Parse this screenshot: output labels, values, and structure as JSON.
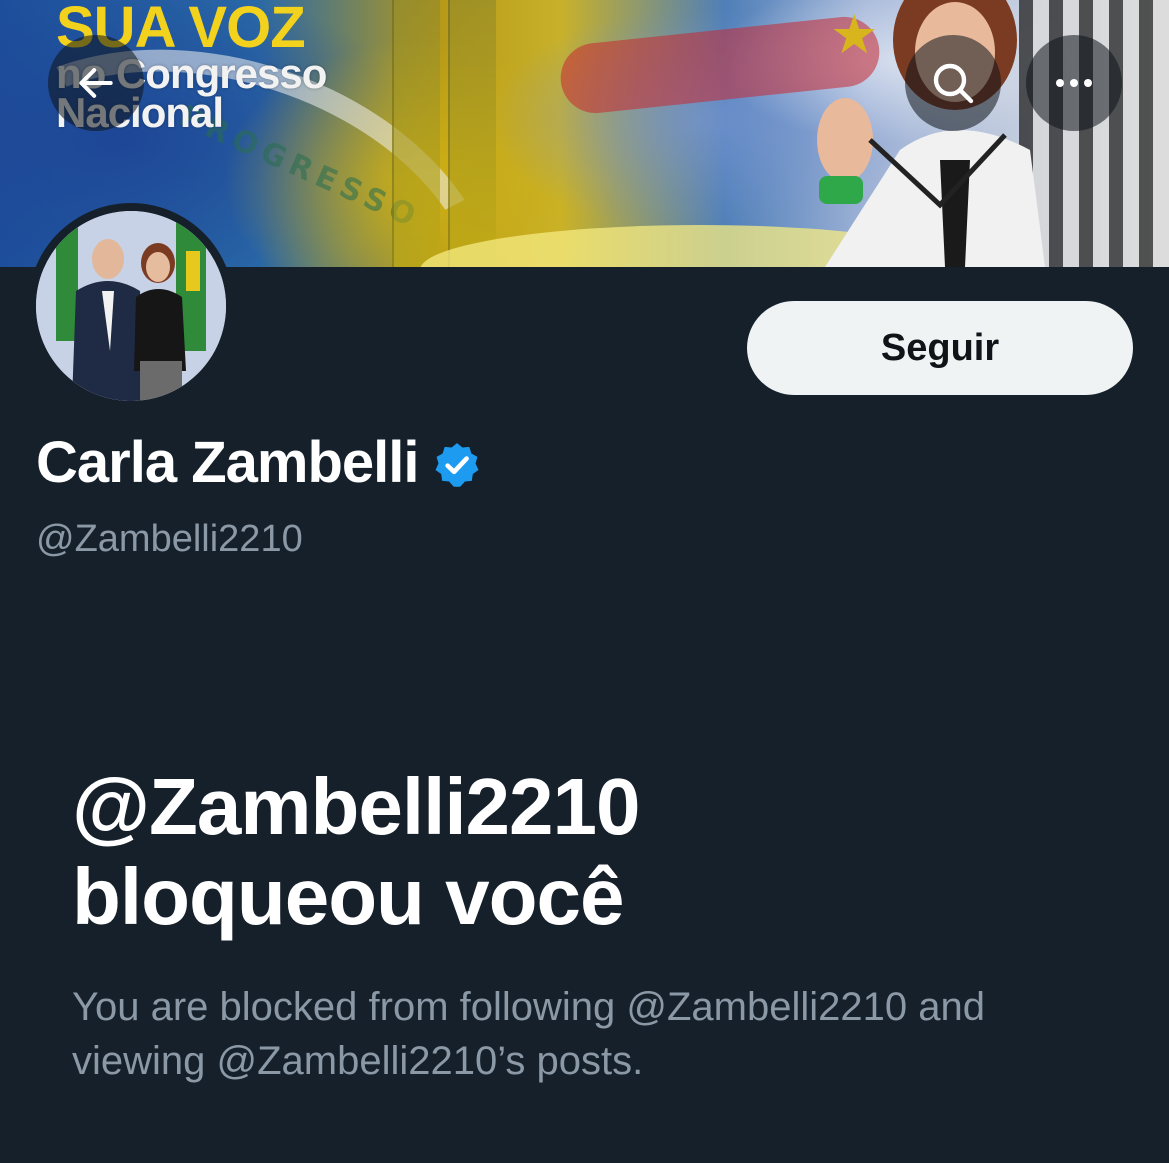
{
  "banner": {
    "headline": "SUA VOZ",
    "line2": "no Congresso",
    "line3": "Nacional",
    "watermark": "PROGRESSO"
  },
  "header": {
    "back_icon": "arrow-left-icon",
    "search_icon": "search-icon",
    "more_icon": "more-horizontal-icon"
  },
  "profile": {
    "display_name": "Carla Zambelli",
    "verified": true,
    "verified_color": "#1d9bf0",
    "handle": "@Zambelli2210",
    "follow_label": "Seguir"
  },
  "blocked": {
    "title_line1": "@Zambelli2210",
    "title_line2": "bloqueou você",
    "description": "You are blocked from following @Zambelli2210 and viewing @Zambelli2210’s posts."
  },
  "colors": {
    "background": "#15202b",
    "primary_text": "#ffffff",
    "secondary_text": "#8b98a5",
    "follow_button_bg": "#eff3f4",
    "follow_button_text": "#0f1419",
    "banner_headline": "#f2d21c"
  }
}
